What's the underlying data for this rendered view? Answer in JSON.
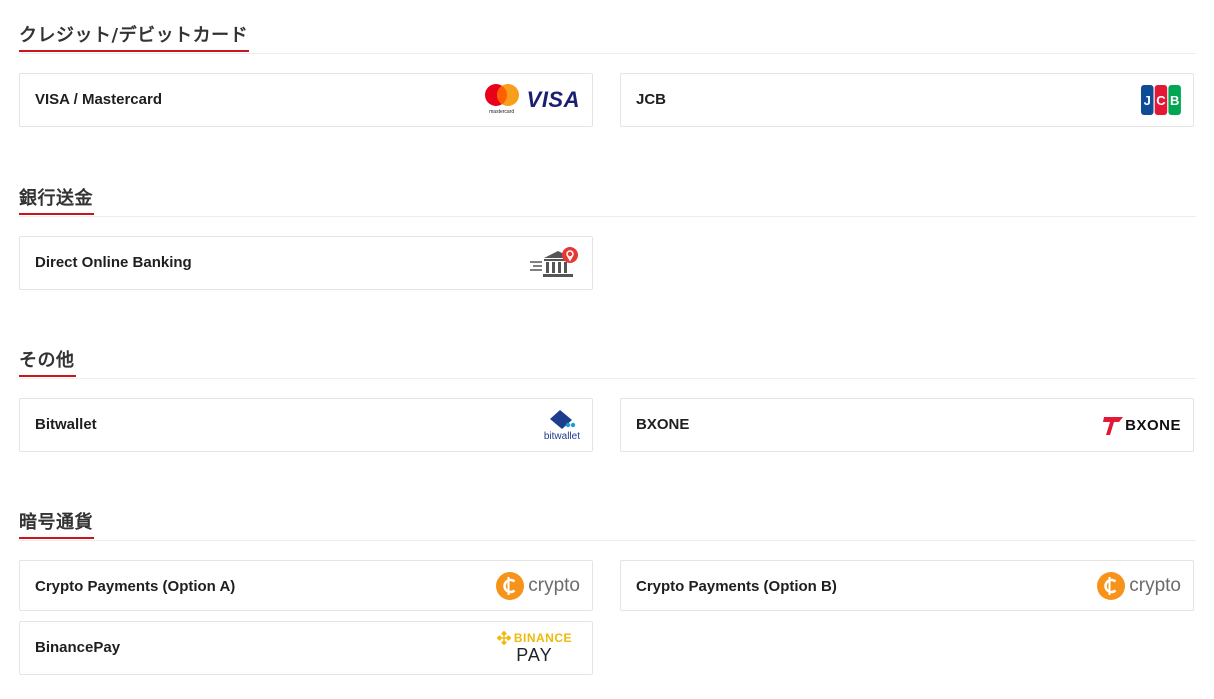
{
  "sections": [
    {
      "title": "クレジット/デビットカード",
      "items": [
        {
          "label": "VISA / Mastercard",
          "logo": "visa-mastercard-logo",
          "mastercard_caption": "mastercard",
          "visa_text": "VISA"
        },
        {
          "label": "JCB",
          "logo": "jcb-logo",
          "jcb_text": [
            "J",
            "C",
            "B"
          ]
        }
      ]
    },
    {
      "title": "銀行送金",
      "items": [
        {
          "label": "Direct Online Banking",
          "logo": "bank-transfer-icon"
        }
      ]
    },
    {
      "title": "その他",
      "items": [
        {
          "label": "Bitwallet",
          "logo": "bitwallet-logo",
          "logo_text": "bitwallet"
        },
        {
          "label": "BXONE",
          "logo": "bxone-logo",
          "logo_text": "BXONE"
        }
      ]
    },
    {
      "title": "暗号通貨",
      "items": [
        {
          "label": "Crypto Payments (Option A)",
          "logo": "crypto-logo",
          "logo_text": "crypto"
        },
        {
          "label": "Crypto Payments (Option B)",
          "logo": "crypto-logo",
          "logo_text": "crypto"
        },
        {
          "label": "BinancePay",
          "logo": "binance-pay-logo",
          "logo_text_top": "BINANCE",
          "logo_text_bottom": "PAY"
        }
      ]
    }
  ],
  "colors": {
    "accent_underline": "#c8161d",
    "visa_blue": "#1a1f71",
    "crypto_orange": "#f7931a",
    "binance_yellow": "#f0b90b",
    "bank_pin_red": "#e53935"
  }
}
